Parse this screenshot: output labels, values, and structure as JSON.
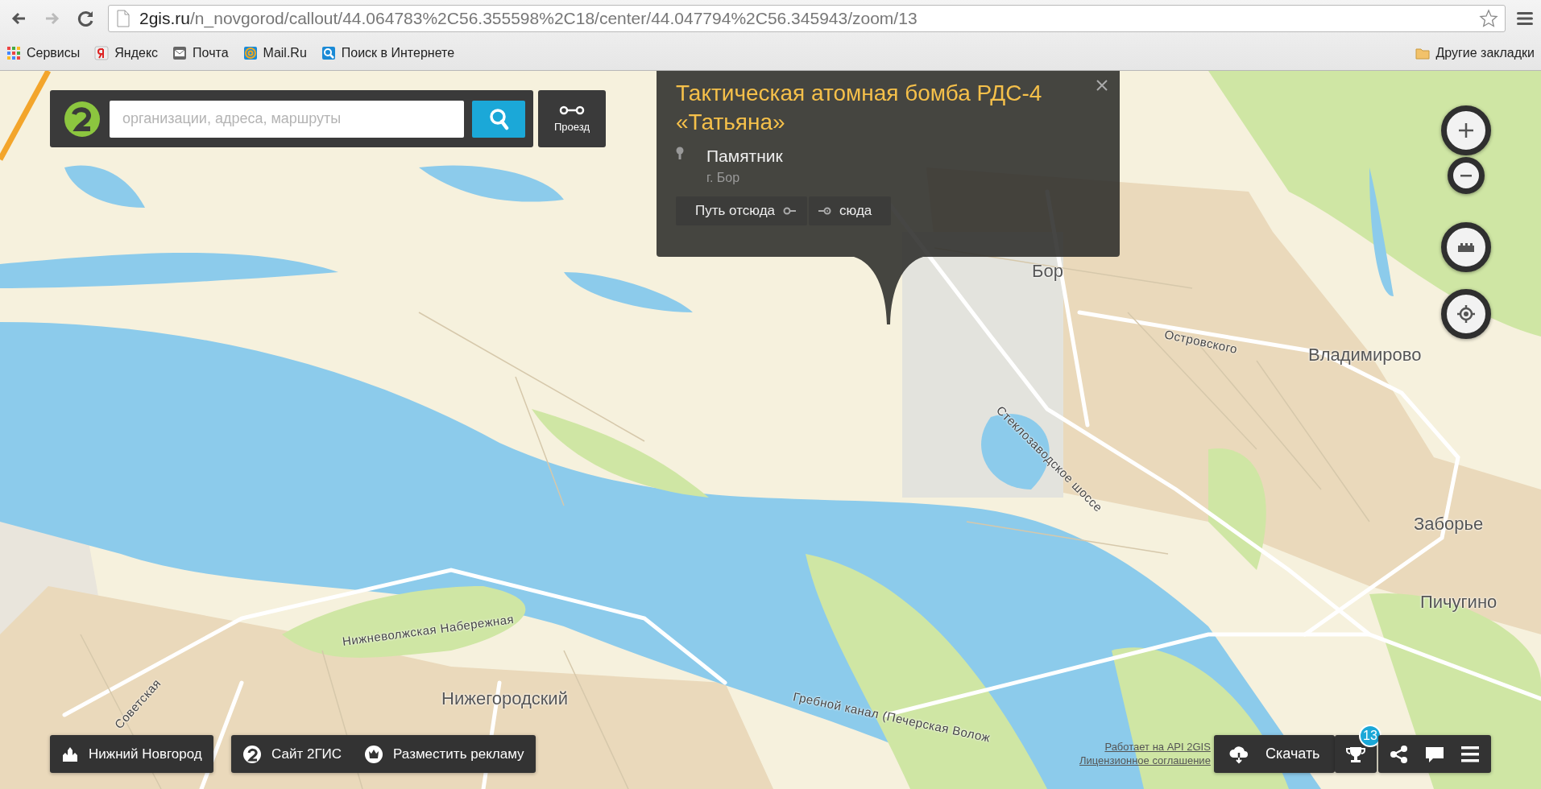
{
  "browser": {
    "address": {
      "host": "2gis.ru",
      "path": "/n_novgorod/callout/44.064783%2C56.355598%2C18/center/44.047794%2C56.345943/zoom/13"
    },
    "bookmarks": [
      {
        "label": "Сервисы"
      },
      {
        "label": "Яндекс"
      },
      {
        "label": "Почта"
      },
      {
        "label": "Mail.Ru"
      },
      {
        "label": "Поиск в Интернете"
      }
    ],
    "other_bookmarks": "Другие закладки"
  },
  "search": {
    "placeholder": "организации, адреса, маршруты",
    "route_button": "Проезд"
  },
  "callout": {
    "title": "Тактическая атомная бомба РДС-4 «Татьяна»",
    "category": "Памятник",
    "city": "г. Бор",
    "route_from": "Путь отсюда",
    "route_to": "сюда"
  },
  "map_labels": [
    {
      "text": "Бор",
      "kind": "place"
    },
    {
      "text": "Островского",
      "kind": "street"
    },
    {
      "text": "Владимирово",
      "kind": "place"
    },
    {
      "text": "Стеклозаводское шоссе",
      "kind": "street"
    },
    {
      "text": "Заборье",
      "kind": "place"
    },
    {
      "text": "Пичугино",
      "kind": "place"
    },
    {
      "text": "Нижневолжская Набережная",
      "kind": "street"
    },
    {
      "text": "Советская",
      "kind": "street"
    },
    {
      "text": "Нижегородский",
      "kind": "place"
    },
    {
      "text": "Гребной канал (Печерская Волож",
      "kind": "street"
    }
  ],
  "bottom_left": {
    "city": "Нижний Новгород",
    "site": "Сайт 2ГИС",
    "ads": "Разместить рекламу"
  },
  "credits": [
    "Работает на API 2GIS",
    "Лицензионное соглашение"
  ],
  "download": "Скачать",
  "achievements_badge": "13"
}
